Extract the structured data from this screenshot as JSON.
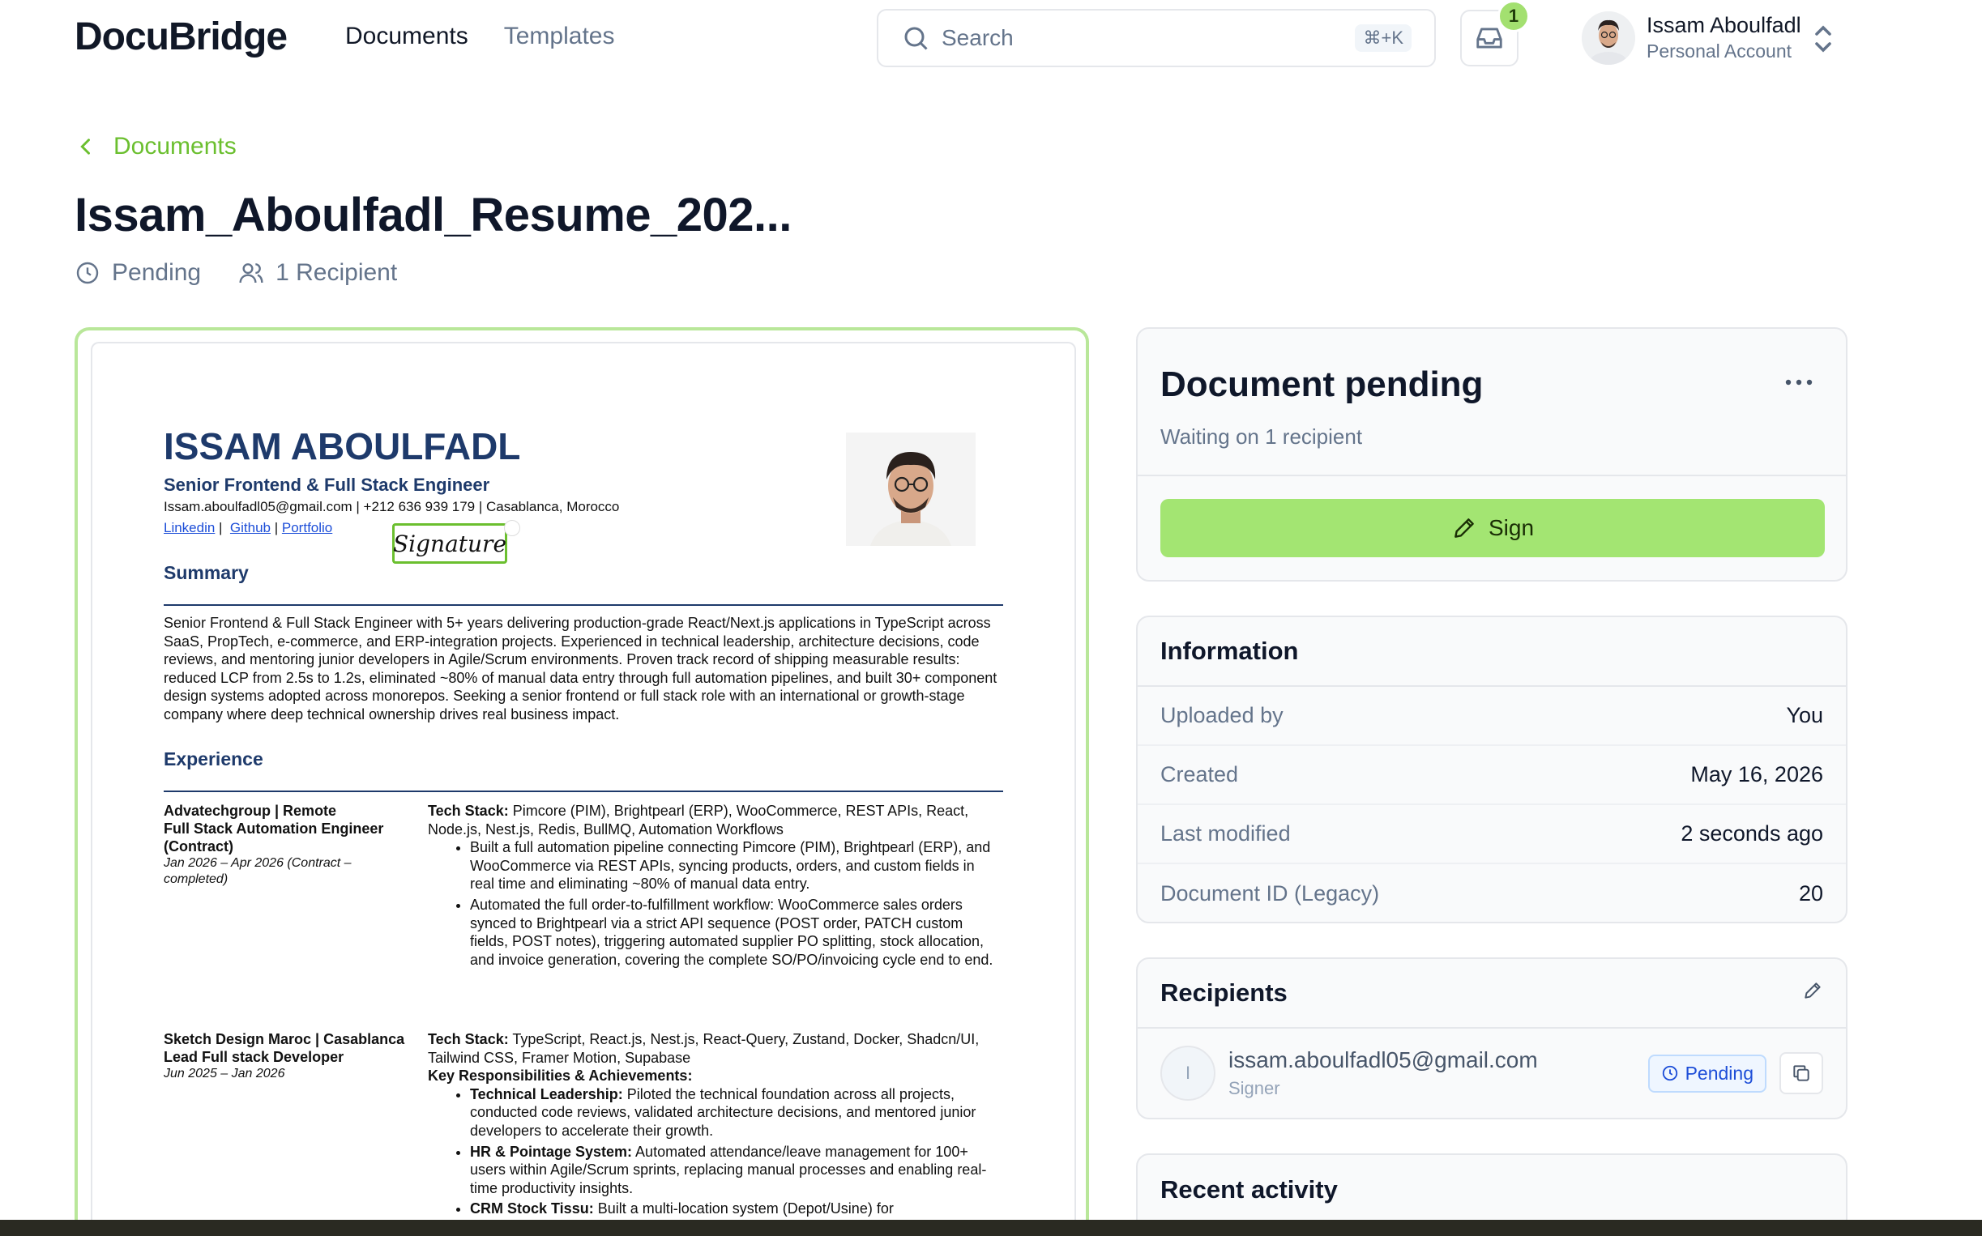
{
  "header": {
    "logo": "DocuBridge",
    "nav": [
      "Documents",
      "Templates"
    ],
    "search_placeholder": "Search",
    "search_shortcut": "⌘+K",
    "inbox_count": "1",
    "user_name": "Issam Aboulfadl",
    "user_account": "Personal Account"
  },
  "breadcrumb": {
    "back_label": "Documents"
  },
  "document": {
    "title": "Issam_Aboulfadl_Resume_202...",
    "status": "Pending",
    "recipients": "1 Recipient"
  },
  "resume": {
    "name": "ISSAM ABOULFADL",
    "role": "Senior Frontend & Full Stack Engineer",
    "contact": "Issam.aboulfadl05@gmail.com  | +212 636 939 179 | Casablanca, Morocco",
    "links": [
      "Linkedin",
      "Github",
      "Portfolio"
    ],
    "signature_field": "Signature",
    "summary_heading": "Summary",
    "summary": "Senior Frontend & Full Stack Engineer with 5+ years delivering production-grade React/Next.js applications in TypeScript across SaaS, PropTech, e-commerce, and ERP-integration projects. Experienced in technical leadership, architecture decisions, code reviews, and mentoring junior developers in Agile/Scrum environments. Proven track record of shipping measurable results: reduced LCP from 2.5s to 1.2s, eliminated ~80% of manual data entry through full automation pipelines, and built 30+ component design systems adopted across monorepos. Seeking a senior frontend or full stack role with an international or growth-stage company where deep technical ownership drives real business impact.",
    "experience_heading": "Experience",
    "jobs": [
      {
        "company": "Advatechgroup  |  Remote",
        "title": "Full Stack Automation Engineer (Contract)",
        "dates": "Jan 2026 – Apr 2026  (Contract – completed)",
        "tech_label": "Tech Stack:",
        "tech": " Pimcore (PIM), Brightpearl (ERP), WooCommerce, REST APIs, React, Node.js, Nest.js, Redis, BullMQ, Automation Workflows",
        "bullets": [
          "Built a full automation pipeline connecting Pimcore (PIM), Brightpearl (ERP), and WooCommerce via REST APIs, syncing products, orders, and custom fields in real time and eliminating ~80% of manual data entry.",
          "Automated the full order-to-fulfillment workflow: WooCommerce sales orders synced to Brightpearl via a strict API sequence (POST order, PATCH custom fields, POST notes), triggering automated supplier PO splitting, stock allocation, and invoice generation, covering the complete SO/PO/invoicing cycle end to end."
        ]
      },
      {
        "company": "Sketch Design Maroc  |  Casablanca",
        "title": "Lead Full stack Developer",
        "dates": "Jun 2025 – Jan 2026",
        "tech_label": "Tech Stack:",
        "tech": " TypeScript, React.js, Nest.js, React-Query, Zustand, Docker, Shadcn/UI, Tailwind CSS, Framer Motion, Supabase",
        "resp_heading": "Key Responsibilities & Achievements:",
        "bullets": [
          {
            "lead": "Technical Leadership:",
            "text": " Piloted the technical foundation across all projects, conducted code reviews, validated architecture decisions, and mentored junior developers to accelerate their growth."
          },
          {
            "lead": "HR & Pointage System:",
            "text": " Automated attendance/leave management for 100+ users within Agile/Scrum sprints, replacing manual processes and enabling real-time productivity insights."
          },
          {
            "lead": "CRM Stock Tissu:",
            "text": " Built a multi-location system (Depot/Usine) for"
          }
        ]
      }
    ]
  },
  "status_card": {
    "title": "Document pending",
    "subtitle": "Waiting on 1 recipient",
    "sign_label": "Sign"
  },
  "information": {
    "heading": "Information",
    "rows": [
      {
        "label": "Uploaded by",
        "value": "You"
      },
      {
        "label": "Created",
        "value": "May 16, 2026"
      },
      {
        "label": "Last modified",
        "value": "2 seconds ago"
      },
      {
        "label": "Document ID (Legacy)",
        "value": "20"
      }
    ]
  },
  "recipients": {
    "heading": "Recipients",
    "items": [
      {
        "initial": "I",
        "email": "issam.aboulfadl05@gmail.com",
        "role": "Signer",
        "status": "Pending"
      }
    ]
  },
  "activity": {
    "heading": "Recent activity"
  },
  "colors": {
    "accent": "#a3e572",
    "link_green": "#6bbf2f",
    "pending_blue": "#1d4ed8",
    "resume_navy": "#1e3a6b"
  }
}
